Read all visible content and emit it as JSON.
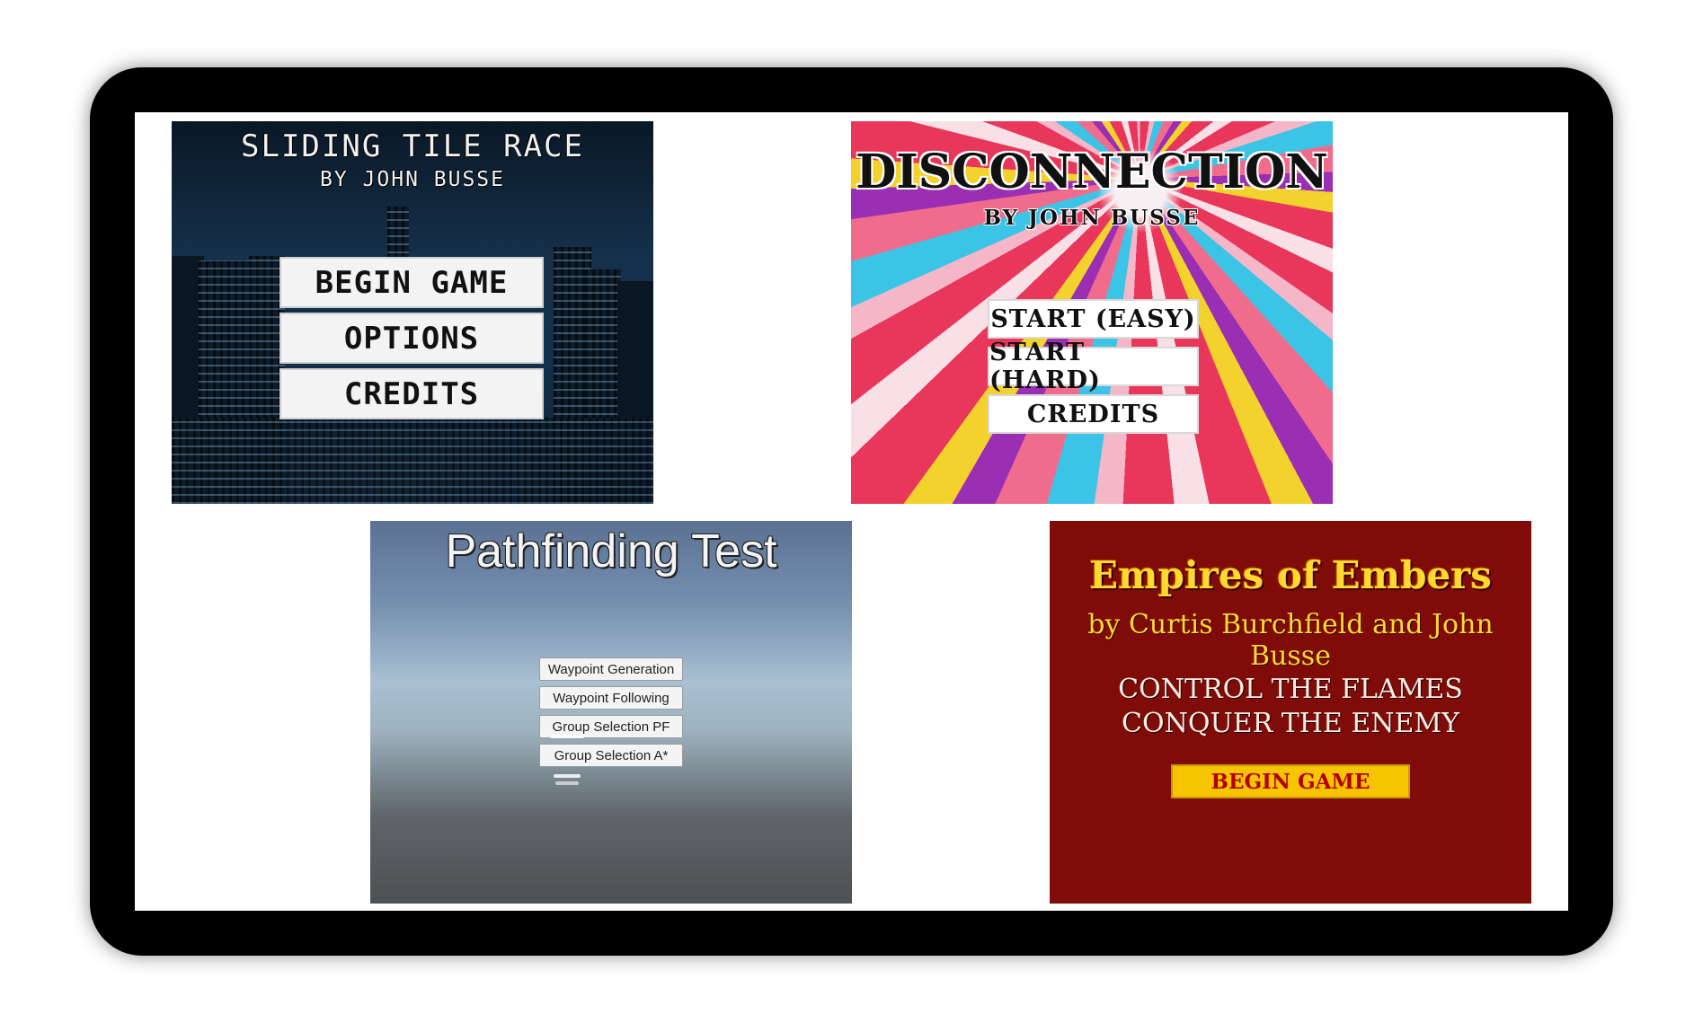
{
  "sliding_tile_race": {
    "title": "SLIDING TILE RACE",
    "byline": "BY JOHN BUSSE",
    "buttons": [
      "BEGIN GAME",
      "OPTIONS",
      "CREDITS"
    ]
  },
  "disconnection": {
    "title": "DISCONNECTION",
    "byline": "BY JOHN BUSSE",
    "buttons": [
      "START (EASY)",
      "START (HARD)",
      "CREDITS"
    ]
  },
  "pathfinding_test": {
    "title": "Pathfinding Test",
    "buttons": [
      "Waypoint Generation",
      "Waypoint Following",
      "Group Selection PF",
      "Group Selection A*"
    ]
  },
  "empires_of_embers": {
    "title": "Empires of Embers",
    "byline": "by Curtis Burchfield and John Busse",
    "tagline_1": "CONTROL THE FLAMES",
    "tagline_2": "CONQUER THE ENEMY",
    "button": "BEGIN GAME"
  }
}
